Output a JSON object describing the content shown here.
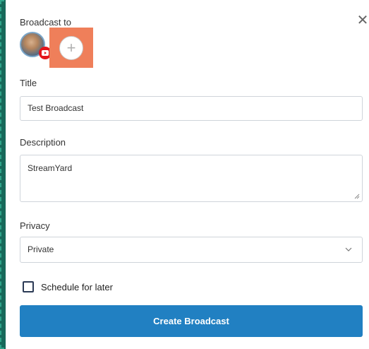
{
  "dialog": {
    "broadcast_to_label": "Broadcast to",
    "close_icon": "close-icon"
  },
  "destinations": {
    "account_avatar": "avatar",
    "platform_icon": "youtube-icon",
    "add_icon": "plus-icon",
    "highlight_color": "#ef7f5a"
  },
  "form": {
    "title_label": "Title",
    "title_value": "Test Broadcast",
    "description_label": "Description",
    "description_value": "StreamYard",
    "privacy_label": "Privacy",
    "privacy_value": "Private",
    "schedule_label": "Schedule for later",
    "schedule_checked": false
  },
  "actions": {
    "create_label": "Create Broadcast",
    "create_color": "#2180c2"
  }
}
